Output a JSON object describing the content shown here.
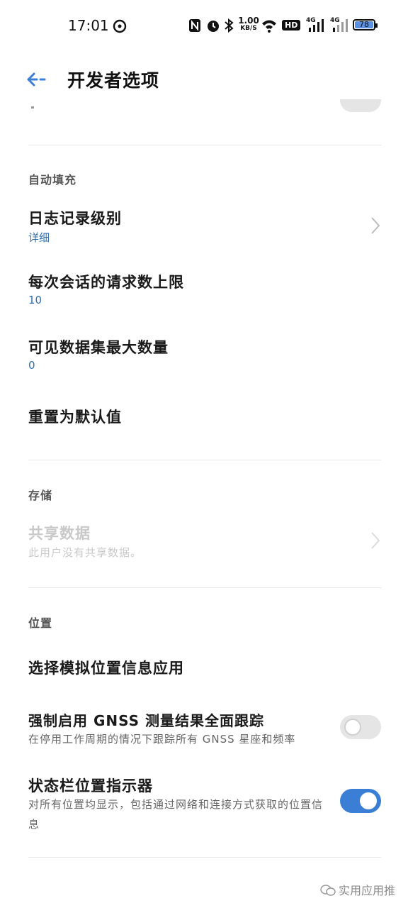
{
  "status": {
    "time": "17:01",
    "speed_top": "1.00",
    "speed_bottom": "KB/S",
    "hd": "HD",
    "net1": "4G",
    "net2": "4G",
    "battery": "78",
    "icons": [
      "netease-music-icon",
      "nfc-icon",
      "alarm-icon",
      "bluetooth-icon",
      "wifi-icon",
      "hd-icon",
      "signal-icon",
      "signal-icon",
      "battery-icon"
    ]
  },
  "header": {
    "title": "开发者选项",
    "back_icon": "back-arrow-icon"
  },
  "autofill": {
    "section": "自动填充",
    "log_level": {
      "title": "日志记录级别",
      "value": "详细"
    },
    "max_requests": {
      "title": "每次会话的请求数上限",
      "value": "10"
    },
    "max_datasets": {
      "title": "可见数据集最大数量",
      "value": "0"
    },
    "reset": {
      "title": "重置为默认值"
    }
  },
  "storage": {
    "section": "存储",
    "shared": {
      "title": "共享数据",
      "desc": "此用户没有共享数据。"
    }
  },
  "location": {
    "section": "位置",
    "mock_app": {
      "title": "选择模拟位置信息应用"
    },
    "gnss": {
      "title": "强制启用 GNSS 测量结果全面跟踪",
      "desc": "在停用工作周期的情况下跟踪所有 GNSS 星座和频率",
      "enabled": false
    },
    "indicator": {
      "title": "状态栏位置指示器",
      "desc": "对所有位置均显示，包括通过网络和连接方式获取的位置信息",
      "enabled": true
    }
  },
  "watermark": "实用应用推",
  "colors": {
    "accent": "#3a7fd5",
    "toggle_off": "#e5e5e5",
    "value_blue": "#2f6fb3"
  }
}
